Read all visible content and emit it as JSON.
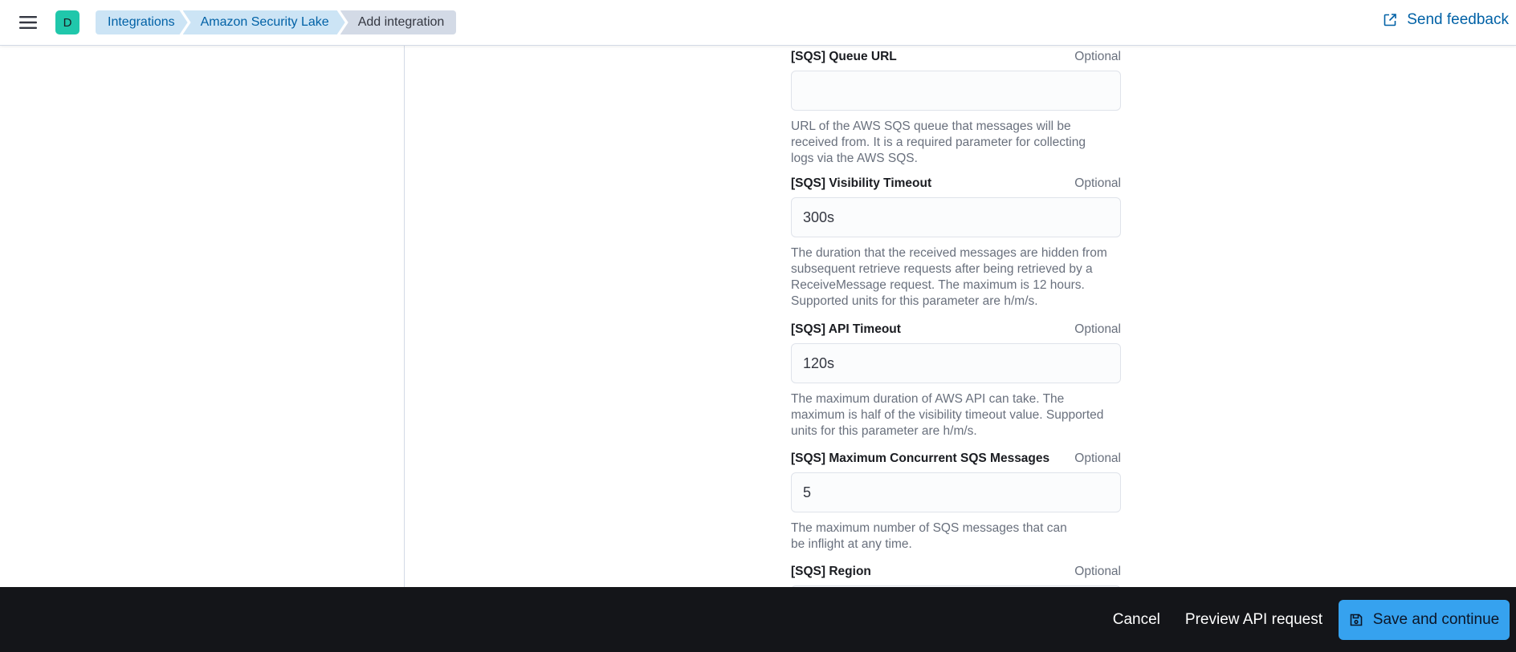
{
  "header": {
    "avatar_letter": "D",
    "breadcrumbs": [
      "Integrations",
      "Amazon Security Lake",
      "Add integration"
    ],
    "feedback_label": "Send feedback"
  },
  "form": {
    "fields": [
      {
        "label": "[SQS] Queue URL",
        "optional": "Optional",
        "value": "",
        "help": "URL of the AWS SQS queue that messages will be received from. It is a required parameter for collecting logs via the AWS SQS."
      },
      {
        "label": "[SQS] Visibility Timeout",
        "optional": "Optional",
        "value": "300s",
        "help": "The duration that the received messages are hidden from subsequent retrieve requests after being retrieved by a ReceiveMessage request. The maximum is 12 hours. Supported units for this parameter are h/m/s."
      },
      {
        "label": "[SQS] API Timeout",
        "optional": "Optional",
        "value": "120s",
        "help": "The maximum duration of AWS API can take. The maximum is half of the visibility timeout value. Supported units for this parameter are h/m/s."
      },
      {
        "label": "[SQS] Maximum Concurrent SQS Messages",
        "optional": "Optional",
        "value": "5",
        "help": "The maximum number of SQS messages that can be inflight at any time."
      },
      {
        "label": "[SQS] Region",
        "optional": "Optional",
        "value": ""
      }
    ]
  },
  "bottom_bar": {
    "cancel_label": "Cancel",
    "preview_label": "Preview API request",
    "save_label": "Save and continue"
  },
  "colors": {
    "accent": "#0061a6",
    "avatar": "#20c7ab",
    "save_button": "#36a2ef",
    "bottom_bar": "#141519"
  }
}
